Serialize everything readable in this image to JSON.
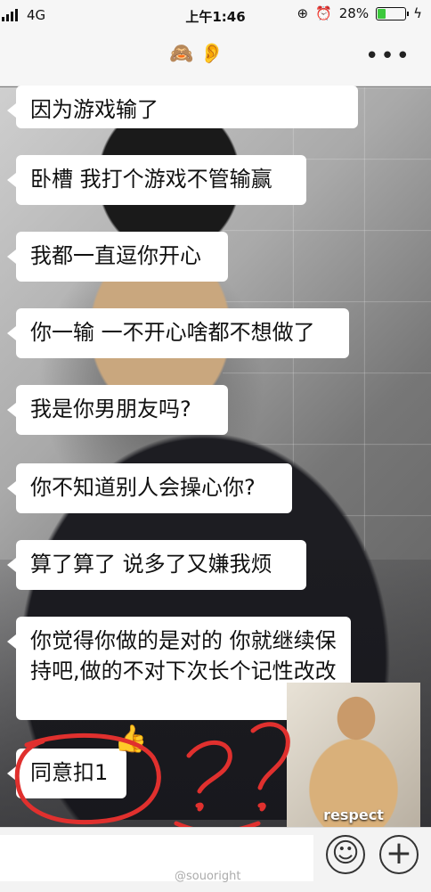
{
  "status_bar": {
    "network": "4G",
    "time": "上午1:46",
    "battery": "28%",
    "battery_level": 0.28
  },
  "header": {
    "more_label": "•••"
  },
  "messages": [
    "因为游戏输了",
    "卧槽 我打个游戏不管输赢",
    "我都一直逗你开心",
    "你一输 一不开心啥都不想做了",
    "我是你男朋友吗?",
    "你不知道别人会操心你?",
    "算了算了 说多了又嫌我烦",
    "你觉得你做的是对的 你就继续保持吧,做的不对下次长个记性改改",
    "同意扣1"
  ],
  "inset_photo": {
    "caption": "respect"
  },
  "annotation": {
    "color": "#e0302e"
  },
  "watermark": "@souoright"
}
